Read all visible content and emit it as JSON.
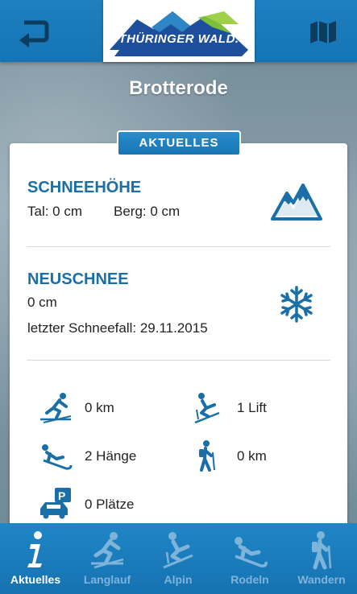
{
  "header": {
    "logo_text": "THÜRINGER WALD.",
    "back_icon": "back-arrow-icon",
    "map_icon": "map-icon"
  },
  "page_title": "Brotterode",
  "tab": {
    "label": "AKTUELLES"
  },
  "snow_depth": {
    "title": "SCHNEEHÖHE",
    "valley": "Tal: 0 cm",
    "mountain": "Berg: 0 cm",
    "icon": "mountain-icon"
  },
  "new_snow": {
    "title": "NEUSCHNEE",
    "amount": "0 cm",
    "last_snowfall": "letzter Schneefall: 29.11.2015",
    "icon": "snowflake-icon"
  },
  "stats": [
    {
      "icon": "cross-country-skier-icon",
      "value": "0 km"
    },
    {
      "icon": "alpine-skier-icon",
      "value": "1 Lift"
    },
    {
      "icon": "sledding-icon",
      "value": "2 Hänge"
    },
    {
      "icon": "hiker-icon",
      "value": "0 km"
    },
    {
      "icon": "parking-icon",
      "value": "0 Plätze"
    }
  ],
  "nav": [
    {
      "label": "Aktuelles",
      "icon": "info-icon",
      "active": true
    },
    {
      "label": "Langlauf",
      "icon": "cross-country-skier-icon",
      "active": false
    },
    {
      "label": "Alpin",
      "icon": "alpine-skier-icon",
      "active": false
    },
    {
      "label": "Rodeln",
      "icon": "sledding-icon",
      "active": false
    },
    {
      "label": "Wandern",
      "icon": "hiker-icon",
      "active": false
    }
  ],
  "colors": {
    "primary_blue": "#1a7ab9",
    "title_blue": "#1a6fa8",
    "nav_inactive": "#7fb4da"
  }
}
